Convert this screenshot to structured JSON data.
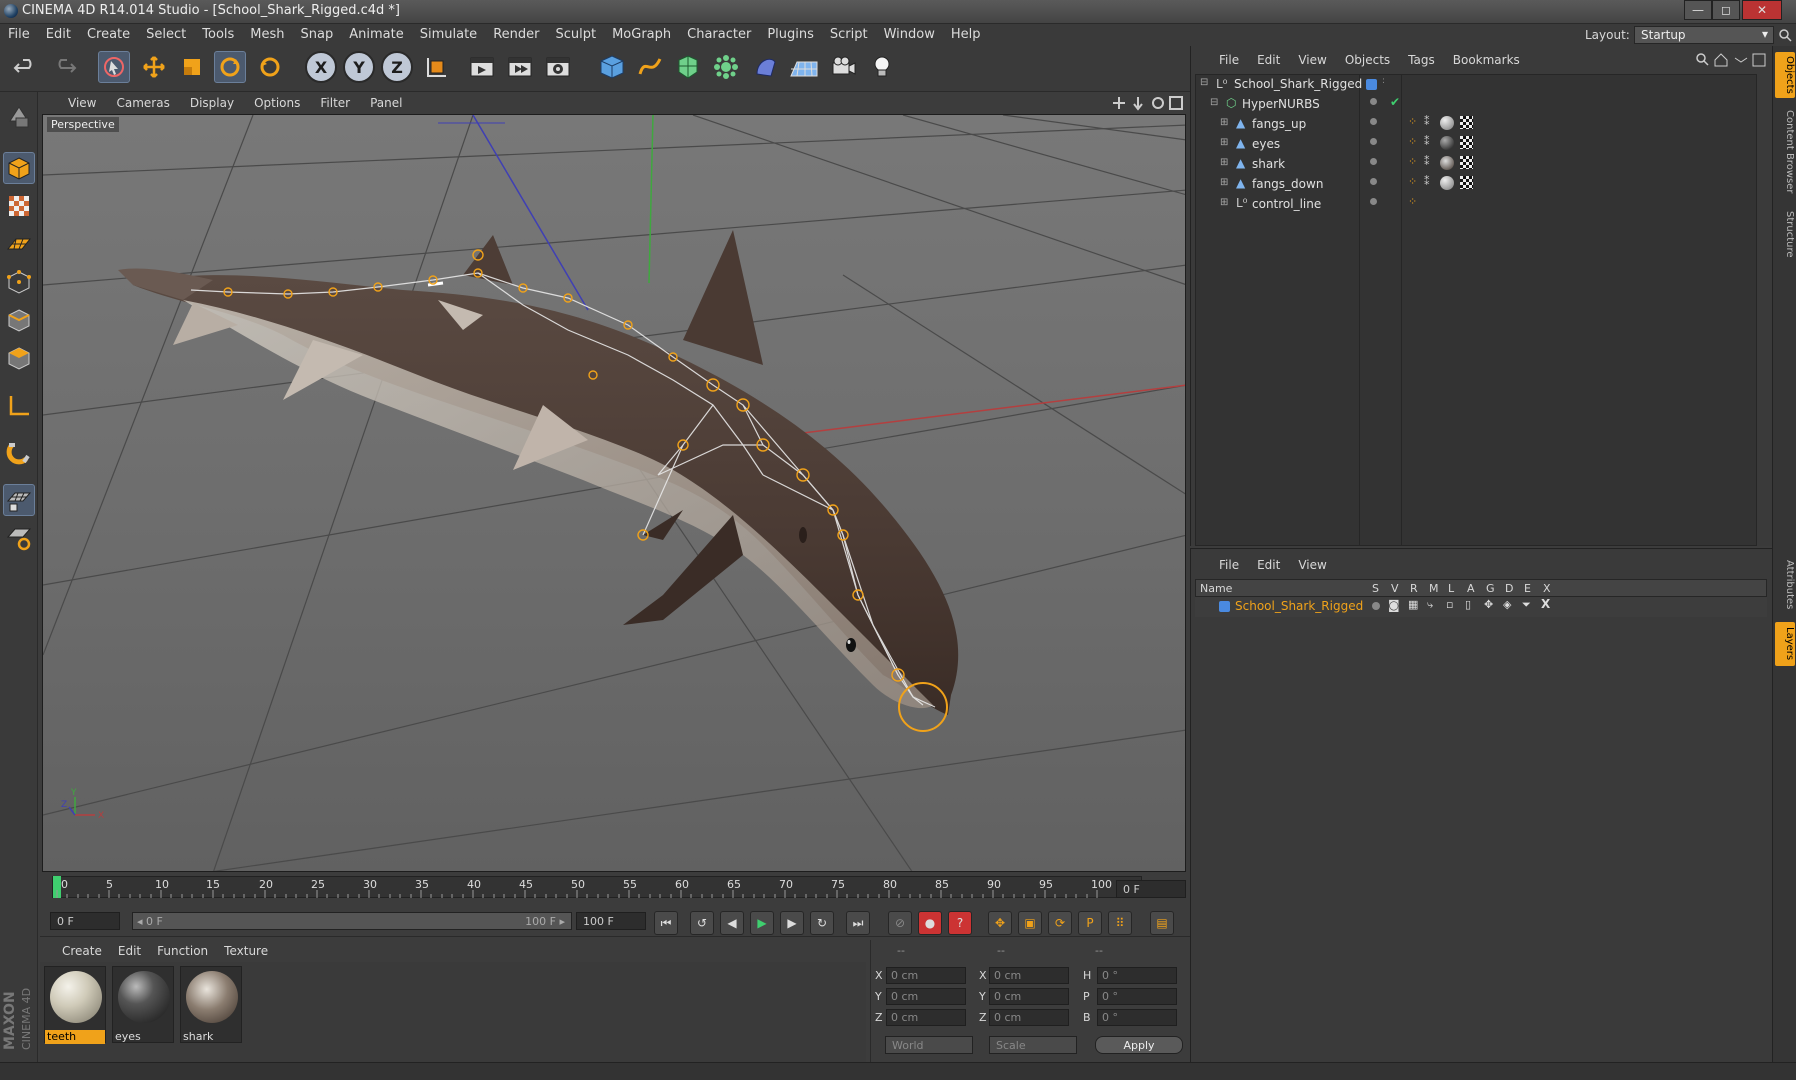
{
  "window": {
    "title": "CINEMA 4D R14.014 Studio - [School_Shark_Rigged.c4d *]",
    "min_label": "—",
    "max_label": "◻",
    "close_label": "✕"
  },
  "menubar": {
    "items": [
      "File",
      "Edit",
      "Create",
      "Select",
      "Tools",
      "Mesh",
      "Snap",
      "Animate",
      "Simulate",
      "Render",
      "Sculpt",
      "MoGraph",
      "Character",
      "Plugins",
      "Script",
      "Window",
      "Help"
    ]
  },
  "layout": {
    "label": "Layout:",
    "value": "Startup"
  },
  "toolbar": {
    "icons": [
      "undo-icon",
      "redo-icon",
      "live-selection-icon",
      "move-icon",
      "scale-icon",
      "rotate-icon",
      "recent-tool-icon",
      "x-axis-lock",
      "y-axis-lock",
      "z-axis-lock",
      "coordinate-system-icon",
      "render-view-icon",
      "render-picture-viewer-icon",
      "render-settings-icon",
      "cube-primitive-icon",
      "spline-pen-icon",
      "subdivision-nurbs-icon",
      "array-cloner-icon",
      "deformer-icon",
      "floor-environment-icon",
      "camera-icon",
      "light-icon"
    ],
    "x_label": "X",
    "y_label": "Y",
    "z_label": "Z"
  },
  "viewport": {
    "menu": [
      "View",
      "Cameras",
      "Display",
      "Options",
      "Filter",
      "Panel"
    ],
    "label": "Perspective"
  },
  "timeline": {
    "ticks": [
      "0",
      "5",
      "10",
      "15",
      "20",
      "25",
      "30",
      "35",
      "40",
      "45",
      "50",
      "55",
      "60",
      "65",
      "70",
      "75",
      "80",
      "85",
      "90",
      "95",
      "100"
    ],
    "current_frame": "0 F",
    "start_frame": "0 F",
    "range_start": "◂ 0 F",
    "range_end": "100 F ▸",
    "end_frame": "100 F",
    "preview_end": "100 F"
  },
  "materials": {
    "menu": [
      "Create",
      "Edit",
      "Function",
      "Texture"
    ],
    "items": [
      {
        "name": "teeth",
        "selected": true
      },
      {
        "name": "eyes",
        "selected": false
      },
      {
        "name": "shark",
        "selected": false
      }
    ]
  },
  "coords": {
    "headers": [
      "--",
      "--",
      "--"
    ],
    "rows": [
      {
        "a": "X",
        "av": "0 cm",
        "b": "X",
        "bv": "0 cm",
        "c": "H",
        "cv": "0 °"
      },
      {
        "a": "Y",
        "av": "0 cm",
        "b": "Y",
        "bv": "0 cm",
        "c": "P",
        "cv": "0 °"
      },
      {
        "a": "Z",
        "av": "0 cm",
        "b": "Z",
        "bv": "0 cm",
        "c": "B",
        "cv": "0 °"
      }
    ],
    "world": "World",
    "scale": "Scale",
    "apply": "Apply"
  },
  "objects": {
    "menu": [
      "File",
      "Edit",
      "View",
      "Objects",
      "Tags",
      "Bookmarks"
    ],
    "rows": [
      {
        "name": "School_Shark_Rigged",
        "depth": 0
      },
      {
        "name": "HyperNURBS",
        "depth": 1
      },
      {
        "name": "fangs_up",
        "depth": 2
      },
      {
        "name": "eyes",
        "depth": 2
      },
      {
        "name": "shark",
        "depth": 2
      },
      {
        "name": "fangs_down",
        "depth": 2
      },
      {
        "name": "control_line",
        "depth": 2
      }
    ]
  },
  "layers": {
    "menu": [
      "File",
      "Edit",
      "View"
    ],
    "columns": [
      "Name",
      "S",
      "V",
      "R",
      "M",
      "L",
      "A",
      "G",
      "D",
      "E",
      "X"
    ],
    "row": "School_Shark_Rigged"
  },
  "sidetabs": [
    "Objects",
    "Content Browser",
    "Structure",
    "Attributes",
    "Layers"
  ],
  "branding": {
    "maxon": "MAXON",
    "product": "CINEMA 4D"
  },
  "colors": {
    "accent": "#f0a21a",
    "selection_blue": "#4c5a6e",
    "viewport_bg": "#6e6e6e"
  }
}
